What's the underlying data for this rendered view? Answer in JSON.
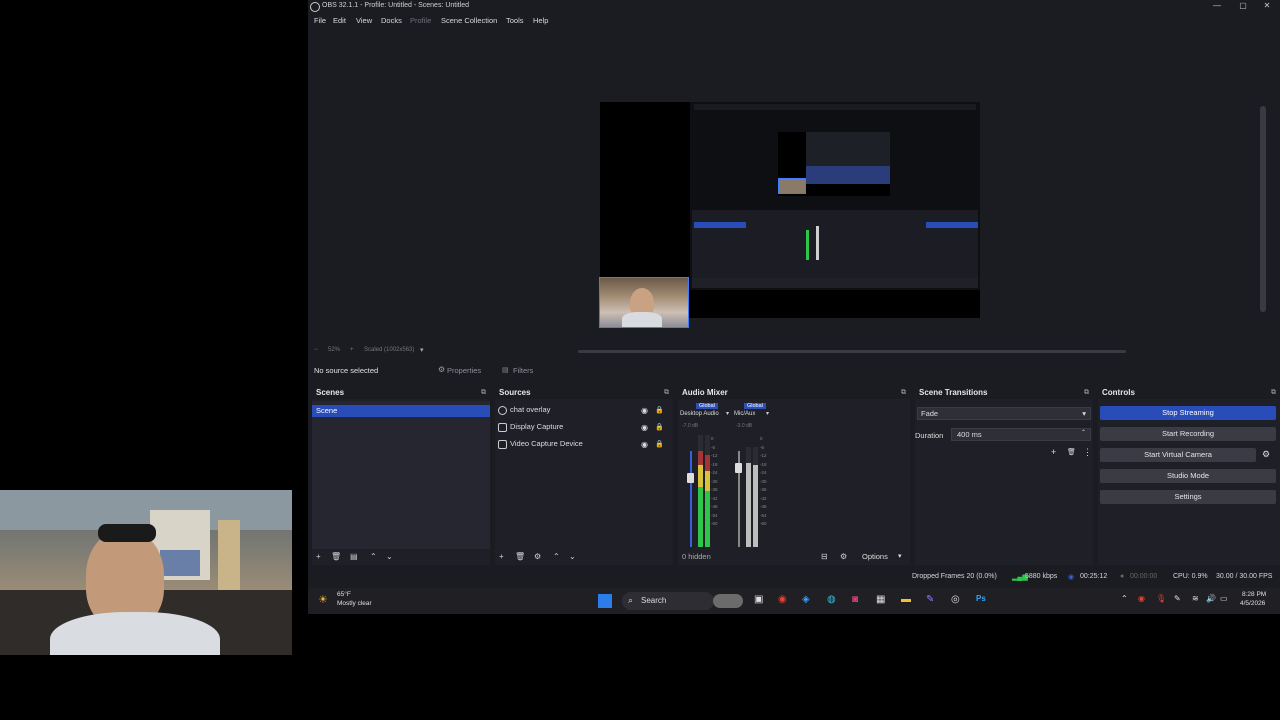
{
  "window": {
    "title": "OBS 32.1.1 - Profile: Untitled - Scenes: Untitled",
    "controls": [
      "—",
      "▢",
      "✕"
    ]
  },
  "menu": [
    "File",
    "Edit",
    "View",
    "Docks",
    "Profile",
    "Scene Collection",
    "Tools",
    "Help"
  ],
  "preview": {
    "zoom": "52%",
    "scale_label": "Scaled (1002x563)"
  },
  "source_toolbar": {
    "status": "No source selected",
    "properties": "Properties",
    "filters": "Filters"
  },
  "scenes": {
    "title": "Scenes",
    "items": [
      "Scene"
    ]
  },
  "sources": {
    "title": "Sources",
    "items": [
      {
        "label": "chat overlay",
        "icon": "browser-icon"
      },
      {
        "label": "Display Capture",
        "icon": "monitor-icon"
      },
      {
        "label": "Video Capture Device",
        "icon": "camera-icon"
      }
    ]
  },
  "mixer": {
    "title": "Audio Mixer",
    "channels": [
      {
        "tag": "Global",
        "name": "Desktop Audio",
        "db": "-7.0 dB",
        "level": 0.7
      },
      {
        "tag": "Global",
        "name": "Mic/Aux",
        "db": "-3.0 dB",
        "level": 0.85
      }
    ],
    "scale": [
      "0",
      "-6",
      "-12",
      "-18",
      "-24",
      "-30",
      "-36",
      "-42",
      "-48",
      "-54",
      "-60"
    ],
    "hidden": "0 hidden",
    "options": "Options"
  },
  "transitions": {
    "title": "Scene Transitions",
    "type": "Fade",
    "duration_label": "Duration",
    "duration_value": "400 ms"
  },
  "controls": {
    "title": "Controls",
    "buttons": [
      "Stop Streaming",
      "Start Recording",
      "Start Virtual Camera",
      "Studio Mode",
      "Settings"
    ]
  },
  "statusbar": {
    "dropped": "Dropped Frames 20 (0.0%)",
    "bitrate": "5880 kbps",
    "stream_time": "00:25:12",
    "rec_time": "00:00:00",
    "cpu": "CPU: 0.9%",
    "fps": "30.00 / 30.00 FPS"
  },
  "taskbar": {
    "weather_temp": "65°F",
    "weather_desc": "Mostly clear",
    "search": "Search",
    "time": "8:28 PM",
    "date": "4/5/2026"
  },
  "colors": {
    "accent": "#284cb8",
    "meter_green": "#2fc44a",
    "meter_yellow": "#d8c23a",
    "meter_red": "#c23838"
  }
}
